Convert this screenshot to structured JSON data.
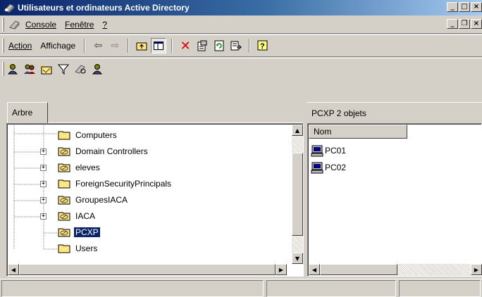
{
  "window": {
    "title": "Utilisateurs et ordinateurs Active Directory",
    "controls": {
      "minimize": "_",
      "maximize": "□",
      "close": "×"
    }
  },
  "menubar": {
    "items": [
      {
        "label": "Console",
        "accel": "C"
      },
      {
        "label": "Fenêtre",
        "accel": "F"
      },
      {
        "label": "?",
        "accel": "?"
      }
    ],
    "mdi_controls": {
      "minimize": "_",
      "restore": "❐",
      "close": "×"
    }
  },
  "toolbar": {
    "action_label": "Action",
    "view_label": "Affichage",
    "buttons": [
      "back-arrow-icon",
      "forward-arrow-icon",
      "up-folder-icon",
      "show-tree-icon",
      "delete-icon",
      "properties-icon",
      "refresh-icon",
      "export-list-icon",
      "help-icon"
    ]
  },
  "toolbar2": {
    "buttons": [
      "new-user-icon",
      "new-group-icon",
      "new-ou-icon",
      "filter-icon",
      "find-icon",
      "add-to-group-icon"
    ]
  },
  "tree": {
    "tab_label": "Arbre",
    "items": [
      {
        "label": "Computers",
        "expandable": false,
        "icon": "folder",
        "selected": false
      },
      {
        "label": "Domain Controllers",
        "expandable": true,
        "icon": "ou-folder",
        "selected": false
      },
      {
        "label": "eleves",
        "expandable": true,
        "icon": "ou-folder",
        "selected": false
      },
      {
        "label": "ForeignSecurityPrincipals",
        "expandable": true,
        "icon": "folder",
        "selected": false
      },
      {
        "label": "GroupesIACA",
        "expandable": true,
        "icon": "ou-folder",
        "selected": false
      },
      {
        "label": "IACA",
        "expandable": true,
        "icon": "ou-folder",
        "selected": false
      },
      {
        "label": "PCXP",
        "expandable": false,
        "icon": "ou-folder",
        "selected": true
      },
      {
        "label": "Users",
        "expandable": false,
        "icon": "folder",
        "selected": false
      }
    ]
  },
  "list": {
    "header_text": "PCXP   2 objets",
    "column_name": "Nom",
    "items": [
      {
        "label": "PC01",
        "icon": "computer-icon"
      },
      {
        "label": "PC02",
        "icon": "computer-icon"
      }
    ]
  },
  "colors": {
    "title_gradient_start": "#0a246a",
    "title_gradient_end": "#a6caf0",
    "selection": "#0a246a",
    "chrome": "#d4d0c8"
  }
}
